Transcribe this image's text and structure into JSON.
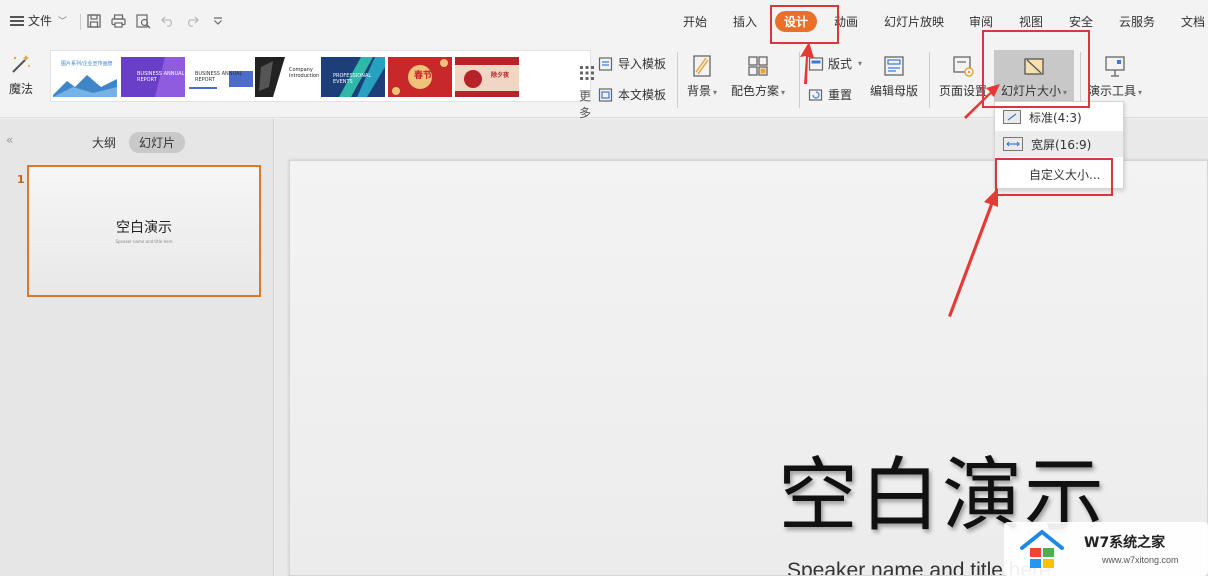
{
  "topbar": {
    "file_label": "文件",
    "tabs": [
      {
        "label": "开始"
      },
      {
        "label": "插入"
      },
      {
        "label": "设计",
        "active": true
      },
      {
        "label": "动画"
      },
      {
        "label": "幻灯片放映"
      },
      {
        "label": "审阅"
      },
      {
        "label": "视图"
      },
      {
        "label": "安全"
      },
      {
        "label": "云服务"
      },
      {
        "label": "文档"
      }
    ],
    "quick_access_icons": [
      "save-icon",
      "print-icon",
      "print-preview-icon",
      "undo-icon",
      "redo-icon",
      "customize-icon"
    ]
  },
  "ribbon": {
    "magic_label": "魔法",
    "gallery": {
      "thumbs": [
        {
          "text": "图片系列/企业宣传画册",
          "bg": "#ffffff"
        },
        {
          "text": "BUSINESS ANNUAL REPORT",
          "bg": "#6a3fc8"
        },
        {
          "text": "BUSINESS ANNUAL REPORT",
          "bg": "#ffffff"
        },
        {
          "text": "Company introduction",
          "bg": "#222222"
        },
        {
          "text": "PROFESSIONAL EVENTS",
          "bg": "#1c3f7a"
        },
        {
          "text": "春节",
          "bg": "#c8282a"
        },
        {
          "text": "除夕夜",
          "bg": "#f2d6c4"
        }
      ],
      "more_label": "更多设计"
    },
    "import_template_label": "导入模板",
    "text_template_label": "本文模板",
    "background_label": "背景",
    "color_scheme_label": "配色方案",
    "layout_label": "版式",
    "reset_label": "重置",
    "edit_master_label": "编辑母版",
    "page_setup_label": "页面设置",
    "slide_size_label": "幻灯片大小",
    "presentation_tools_label": "演示工具"
  },
  "slide_size_menu": {
    "items": [
      {
        "label": "标准(4:3)"
      },
      {
        "label": "宽屏(16:9)"
      },
      {
        "label": "自定义大小..."
      }
    ]
  },
  "left_pane": {
    "outline_tab": "大纲",
    "slides_tab": "幻灯片",
    "slides": [
      {
        "number": "1",
        "title": "空白演示",
        "subtitle": "Speaker name and title here"
      }
    ]
  },
  "slide": {
    "title": "空白演示",
    "subtitle": "Speaker name and title here"
  },
  "watermark": {
    "brand": "W7系统之家",
    "url": "www.w7xitong.com"
  },
  "colors": {
    "accent": "#e8702a",
    "highlight": "#d9363e",
    "arrow": "#e53935"
  }
}
